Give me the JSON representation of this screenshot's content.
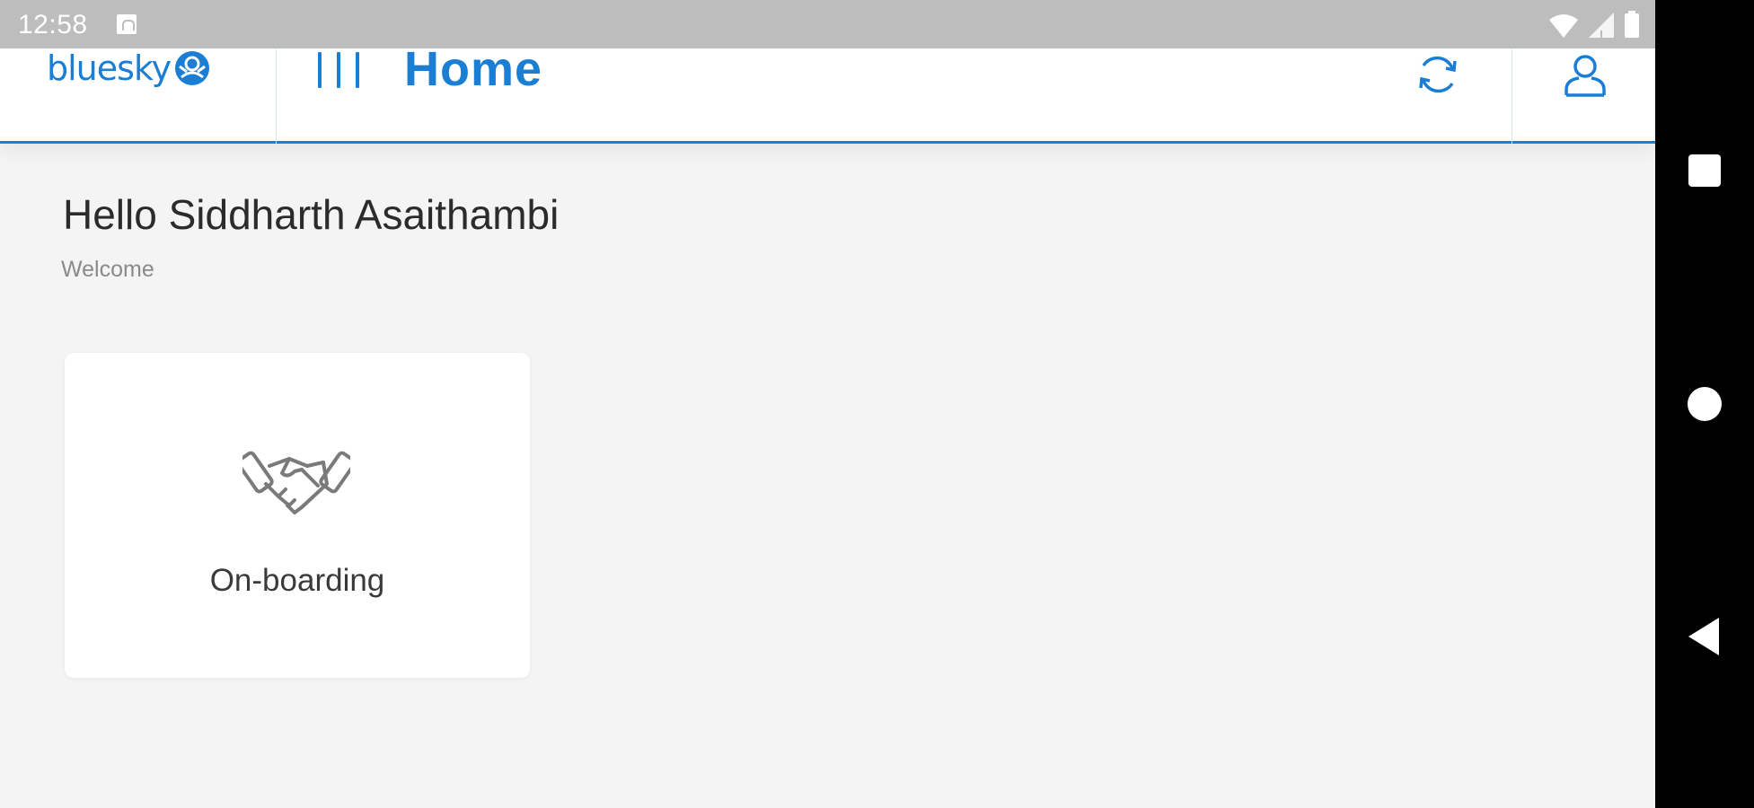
{
  "status_bar": {
    "time": "12:58"
  },
  "header": {
    "logo_text": "bluesky",
    "title": "Home"
  },
  "main": {
    "greeting": "Hello Siddharth Asaithambi",
    "subtitle": "Welcome",
    "cards": [
      {
        "label": "On-boarding",
        "icon": "handshake-icon"
      }
    ]
  },
  "icons": {
    "menu": "menu-icon",
    "sync": "sync-icon",
    "profile": "user-icon",
    "logo_mark": "bluesky-logo-icon"
  },
  "colors": {
    "accent": "#1a7fd4",
    "background": "#f4f4f4",
    "status_bar": "#bdbdbd",
    "card": "#ffffff"
  }
}
